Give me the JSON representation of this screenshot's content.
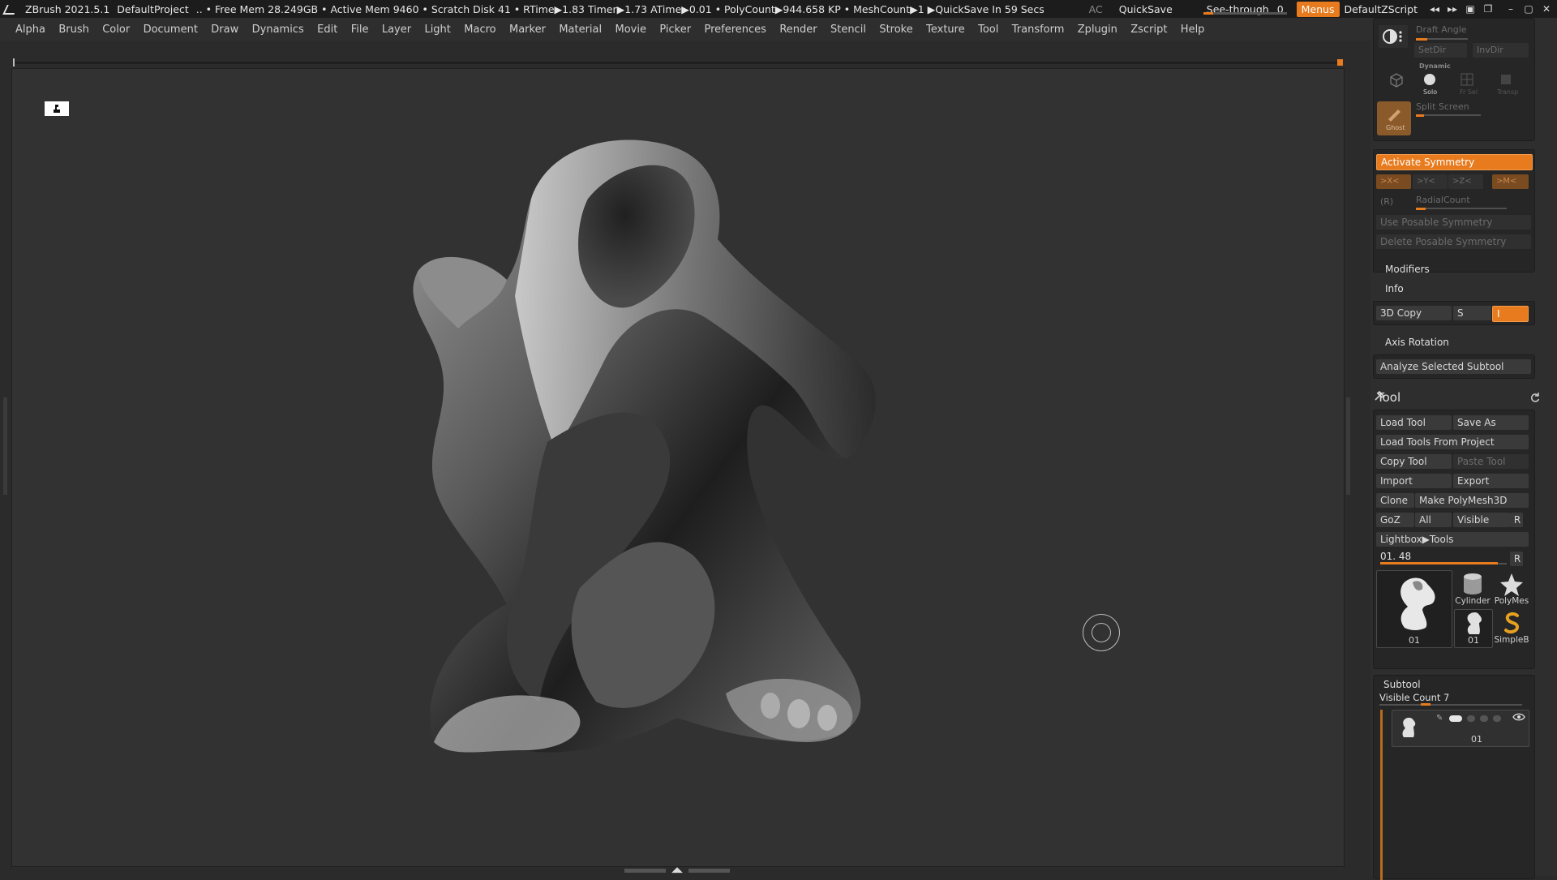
{
  "titlebar": {
    "app": "ZBrush 2021.5.1",
    "project": "DefaultProject",
    "status": ".. • Free Mem 28.249GB • Active Mem 9460 • Scratch Disk 41 •  RTime▶1.83 Timer▶1.73 ATime▶0.01 • PolyCount▶944.658 KP  • MeshCount▶1  ▶QuickSave In 59 Secs",
    "ac": "AC",
    "quicksave": "QuickSave",
    "seethrough_label": "See-through",
    "seethrough_value": "0",
    "menus": "Menus",
    "script": "DefaultZScript"
  },
  "menus": [
    "Alpha",
    "Brush",
    "Color",
    "Document",
    "Draw",
    "Dynamics",
    "Edit",
    "File",
    "Layer",
    "Light",
    "Macro",
    "Marker",
    "Material",
    "Movie",
    "Picker",
    "Preferences",
    "Render",
    "Stencil",
    "Stroke",
    "Texture",
    "Tool",
    "Transform",
    "Zplugin",
    "Zscript",
    "Help"
  ],
  "top_panel": {
    "draft_angle": "Draft Angle",
    "setdir": "SetDir",
    "invdir": "InvDir",
    "dynamic": "Dynamic",
    "solo": "Solo",
    "frtsel": "Fr Sel",
    "transp": "Transp",
    "ghost": "Ghost",
    "split_screen": "Split Screen"
  },
  "symmetry": {
    "activate": "Activate Symmetry",
    "x": ">X<",
    "y": ">Y<",
    "z": ">Z<",
    "m": ">M<",
    "r": "(R)",
    "radial": "RadialCount",
    "use_posable": "Use Posable Symmetry",
    "delete_posable": "Delete Posable Symmetry"
  },
  "sections": {
    "modifiers": "Modifiers",
    "info": "Info",
    "copy3d": "3D Copy",
    "s": "S",
    "i": "I",
    "axis_rotation": "Axis Rotation",
    "analyze": "Analyze Selected Subtool"
  },
  "tool": {
    "title": "Tool",
    "load_tool": "Load Tool",
    "save_as": "Save As",
    "load_from_project": "Load Tools From Project",
    "copy_tool": "Copy Tool",
    "paste_tool": "Paste Tool",
    "import": "Import",
    "export": "Export",
    "clone": "Clone",
    "make_polymesh": "Make PolyMesh3D",
    "goz": "GoZ",
    "all": "All",
    "visible": "Visible",
    "r": "R",
    "lightbox": "Lightbox▶Tools",
    "current": "01. 48",
    "slider_r": "R",
    "slider_level": 0.93,
    "thumbs": {
      "main": "01",
      "cylinder": "Cylinder",
      "polymesh": "PolyMes",
      "small01": "01",
      "simpleb": "SimpleB"
    }
  },
  "subtool": {
    "title": "Subtool",
    "visible_count": "Visible Count 7",
    "item_label": "01"
  },
  "colors": {
    "accent": "#e87b1e",
    "panel": "#2e2e2e",
    "canvas": "#323232"
  }
}
